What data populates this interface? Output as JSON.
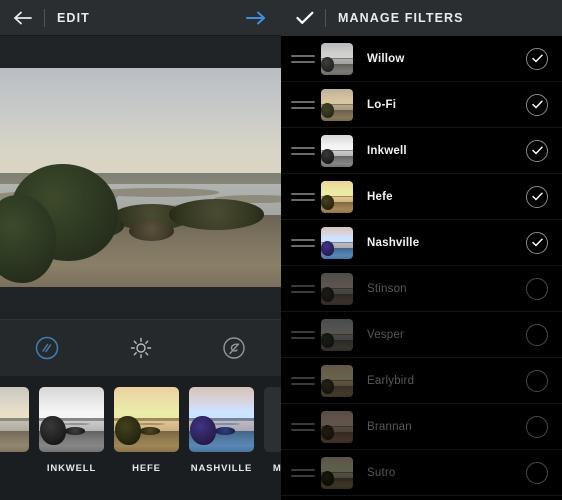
{
  "colors": {
    "accent_blue": "#3f8fe0",
    "header_bg": "#2b2e31",
    "left_bg": "#212427",
    "right_bg": "#000000",
    "label_on": "#f2f2f2",
    "label_off": "#58585a"
  },
  "left_panel": {
    "header": {
      "back_icon": "arrow-left-icon",
      "title": "EDIT",
      "forward_icon": "arrow-right-icon"
    },
    "toolbar": [
      {
        "name": "filter-tool",
        "icon": "filter-circle-icon",
        "active": true
      },
      {
        "name": "brightness-tool",
        "icon": "sun-icon",
        "active": false
      },
      {
        "name": "blur-tool",
        "icon": "blur-swirl-icon",
        "active": false
      }
    ],
    "filter_strip": [
      {
        "label": "",
        "partial": true
      },
      {
        "label": "INKWELL",
        "partial": false
      },
      {
        "label": "HEFE",
        "partial": false
      },
      {
        "label": "NASHVILLE",
        "partial": false
      }
    ],
    "manage_button": {
      "label": "MANAGE",
      "icon": "gear-icon"
    }
  },
  "right_panel": {
    "header": {
      "confirm_icon": "check-icon",
      "title": "MANAGE FILTERS"
    },
    "rows": [
      {
        "label": "Willow",
        "enabled": true
      },
      {
        "label": "Lo-Fi",
        "enabled": true
      },
      {
        "label": "Inkwell",
        "enabled": true
      },
      {
        "label": "Hefe",
        "enabled": true
      },
      {
        "label": "Nashville",
        "enabled": true
      },
      {
        "label": "Stinson",
        "enabled": false
      },
      {
        "label": "Vesper",
        "enabled": false
      },
      {
        "label": "Earlybird",
        "enabled": false
      },
      {
        "label": "Brannan",
        "enabled": false
      },
      {
        "label": "Sutro",
        "enabled": false
      }
    ]
  }
}
